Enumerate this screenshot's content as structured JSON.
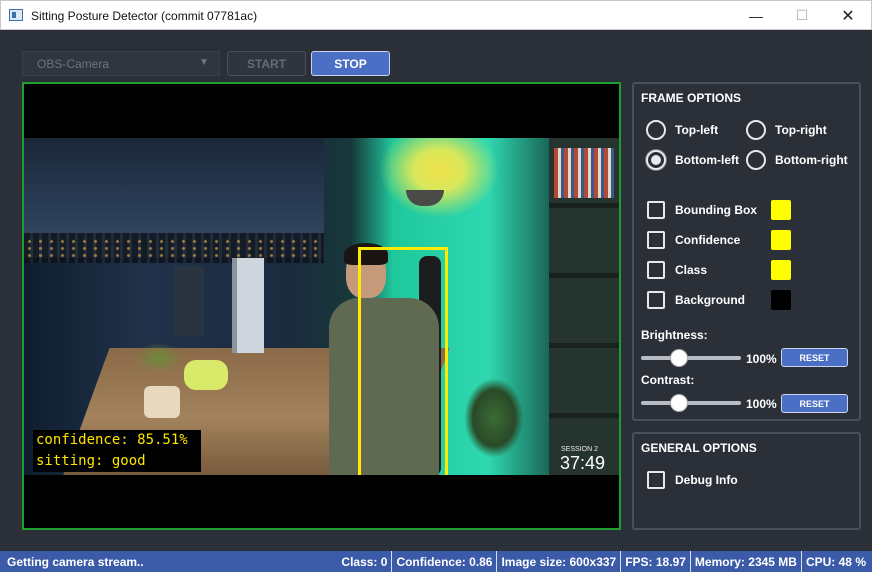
{
  "window": {
    "title": "Sitting Posture Detector (commit 07781ac)",
    "minimize": "—",
    "maximize": "☐",
    "close": "✕"
  },
  "toolbar": {
    "camera_value": "OBS-Camera",
    "start_label": "START",
    "stop_label": "STOP"
  },
  "video": {
    "overlay_line1": "confidence: 85.51%",
    "overlay_line2": "sitting: good",
    "session_label": "SESSION 2",
    "timer": "37:49"
  },
  "frame_options": {
    "title": "FRAME OPTIONS",
    "positions": [
      {
        "label": "Top-left",
        "selected": false
      },
      {
        "label": "Top-right",
        "selected": false
      },
      {
        "label": "Bottom-left",
        "selected": true
      },
      {
        "label": "Bottom-right",
        "selected": false
      }
    ],
    "toggles": [
      {
        "label": "Bounding Box",
        "color": "#ffff00"
      },
      {
        "label": "Confidence",
        "color": "#ffff00"
      },
      {
        "label": "Class",
        "color": "#ffff00"
      },
      {
        "label": "Background",
        "color": "#000000"
      }
    ],
    "brightness": {
      "label": "Brightness:",
      "value": "100%",
      "level": 0.38,
      "reset_label": "RESET"
    },
    "contrast": {
      "label": "Contrast:",
      "value": "100%",
      "level": 0.38,
      "reset_label": "RESET"
    }
  },
  "general_options": {
    "title": "GENERAL OPTIONS",
    "debug_label": "Debug Info"
  },
  "status": {
    "message": "Getting camera stream..",
    "class": "Class: 0",
    "confidence": "Confidence: 0.86",
    "image_size": "Image size: 600x337",
    "fps": "FPS: 18.97",
    "memory": "Memory: 2345 MB",
    "cpu": "CPU: 48 %"
  },
  "colors": {
    "accent": "#4a6fc4",
    "video_border": "#1f9e2f",
    "bbox": "#ffeb00",
    "overlay_text": "#ffe600"
  }
}
